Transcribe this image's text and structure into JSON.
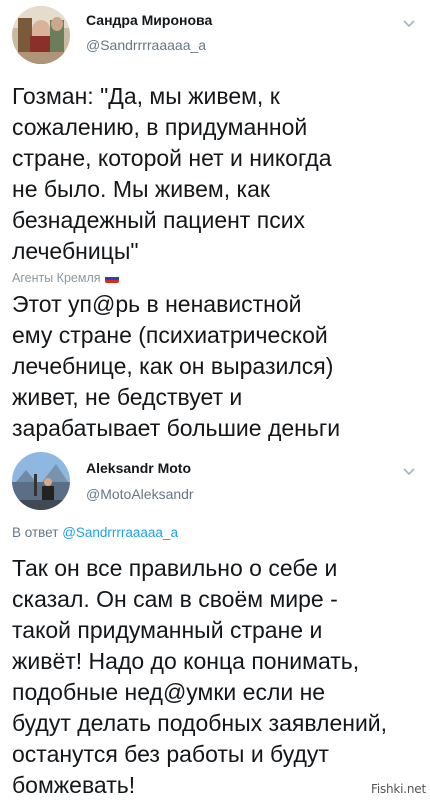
{
  "tweet1": {
    "author_name": "Сандра Миронова",
    "author_handle": "@Sandrrrraaaaa_a",
    "text_lines": [
      "Гозман: \"Да, мы живем, к",
      "сожалению, в придуманной",
      "стране, которой нет и никогда",
      "не было. Мы живем, как",
      "безнадежный пациент псих",
      "лечебницы\""
    ]
  },
  "source_label": "Агенты Кремля",
  "comment": {
    "text_lines": [
      "Этот уп@рь в ненавистной",
      "ему стране (психиатрической",
      "лечебнице, как он выразился)",
      "живет, не бедствует и",
      "зарабатывает большие деньги"
    ]
  },
  "tweet2": {
    "author_name": "Aleksandr Moto",
    "author_handle": "@MotoAleksandr",
    "reply_prefix": "В ответ",
    "reply_handle": "@Sandrrrraaaaa_a",
    "text_lines": [
      "Так он все правильно о себе и",
      "сказал. Он сам в своём мире -",
      "такой придуманный стране и",
      "живёт! Надо до конца понимать,",
      "подобные нед@умки если не",
      "будут делать подобных заявлений,",
      "останутся без работы и будут",
      "бомжевать!"
    ]
  },
  "watermark": "Fishki.net",
  "icons": {
    "menu_chevron": "chevron-down-icon",
    "flag": "russian-flag-icon"
  },
  "colors": {
    "text": "#14171a",
    "secondary": "#657786",
    "link": "#1da1f2",
    "source": "#8899a6"
  }
}
